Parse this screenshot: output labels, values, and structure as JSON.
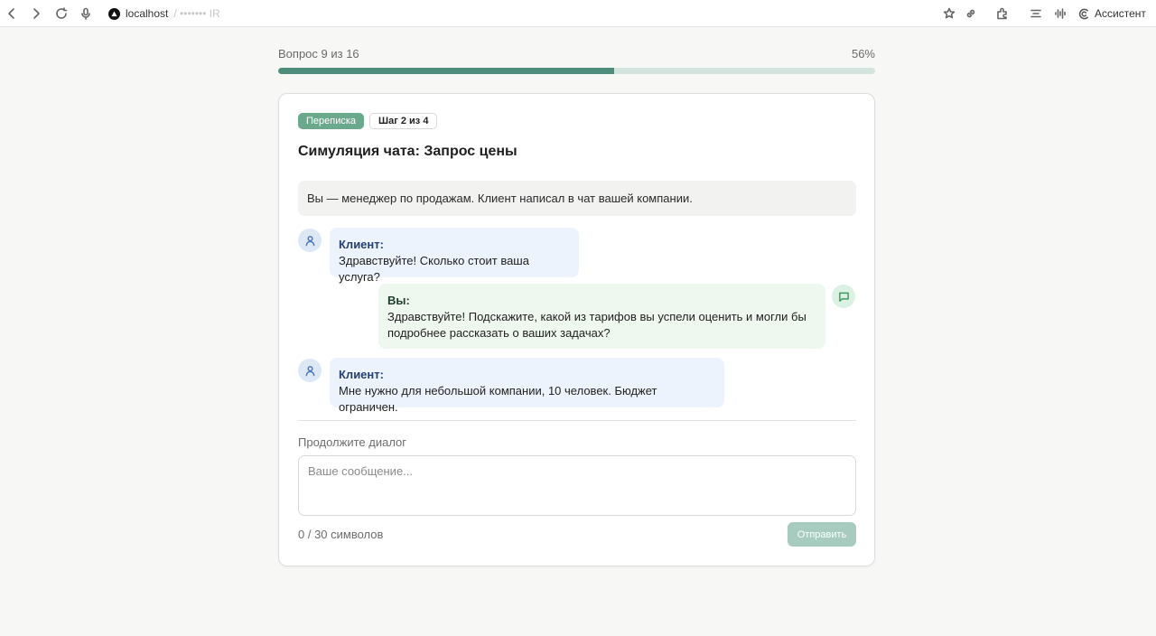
{
  "browser": {
    "url_host": "localhost",
    "url_rest": "/ ••••••• IR",
    "assistant_label": "Ассистент"
  },
  "progress": {
    "label": "Вопрос 9 из 16",
    "percent_label": "56%",
    "fraction": 0.5625
  },
  "card": {
    "category_badge": "Переписка",
    "step_badge": "Шаг 2 из 4",
    "title": "Симуляция чата: Запрос цены",
    "context": "Вы — менеджер по продажам. Клиент написал в чат вашей компании.",
    "messages": [
      {
        "role": "client",
        "author": "Клиент:",
        "text": "Здравствуйте! Сколько стоит ваша услуга?"
      },
      {
        "role": "you",
        "author": "Вы:",
        "text_line1": "Здравствуйте! Подскажите, какой из тарифов вы успели оценить и могли бы",
        "text_line2": "подробнее рассказать о ваших задачах?"
      },
      {
        "role": "client",
        "author": "Клиент:",
        "text": "Мне нужно для небольшой компании, 10 человек. Бюджет ограничен."
      }
    ],
    "reply_prompt": "Продолжите диалог",
    "reply_placeholder": "Ваше сообщение...",
    "reply_value": "",
    "char_counter": "0 / 30 символов",
    "send_label": "Отправить"
  },
  "icons": {
    "client_avatar": "user-icon",
    "you_avatar": "chat-bubble-icon"
  },
  "colors": {
    "accent": "#4e8c7c",
    "progress_track": "#d3e3dd",
    "category_badge": "#6aa98c",
    "send_disabled": "#a8cbc0",
    "client_bubble": "#edf3fc",
    "you_bubble": "#eef8ef"
  }
}
